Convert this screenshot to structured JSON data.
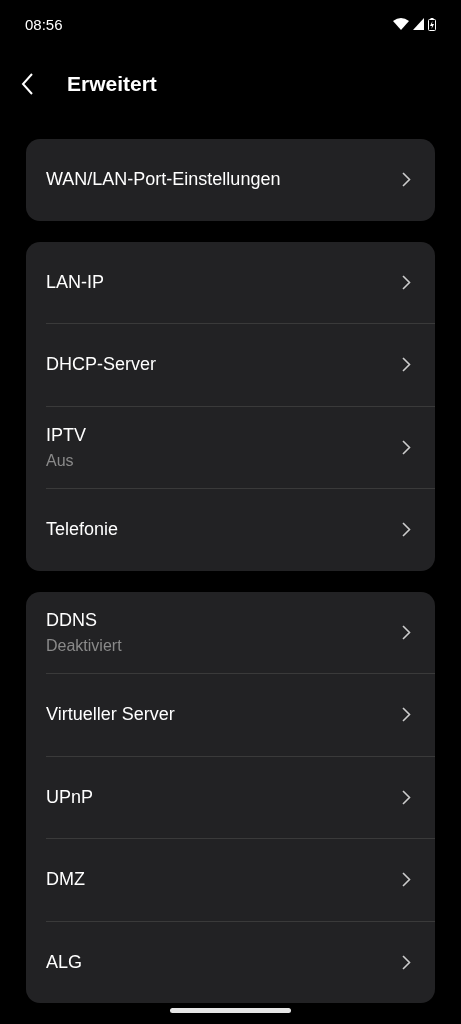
{
  "status_bar": {
    "time": "08:56"
  },
  "header": {
    "title": "Erweitert"
  },
  "groups": [
    {
      "items": [
        {
          "label": "WAN/LAN-Port-Einstellungen"
        }
      ]
    },
    {
      "items": [
        {
          "label": "LAN-IP"
        },
        {
          "label": "DHCP-Server"
        },
        {
          "label": "IPTV",
          "subtitle": "Aus"
        },
        {
          "label": "Telefonie"
        }
      ]
    },
    {
      "items": [
        {
          "label": "DDNS",
          "subtitle": "Deaktiviert"
        },
        {
          "label": "Virtueller Server"
        },
        {
          "label": "UPnP"
        },
        {
          "label": "DMZ"
        },
        {
          "label": "ALG"
        }
      ]
    }
  ]
}
